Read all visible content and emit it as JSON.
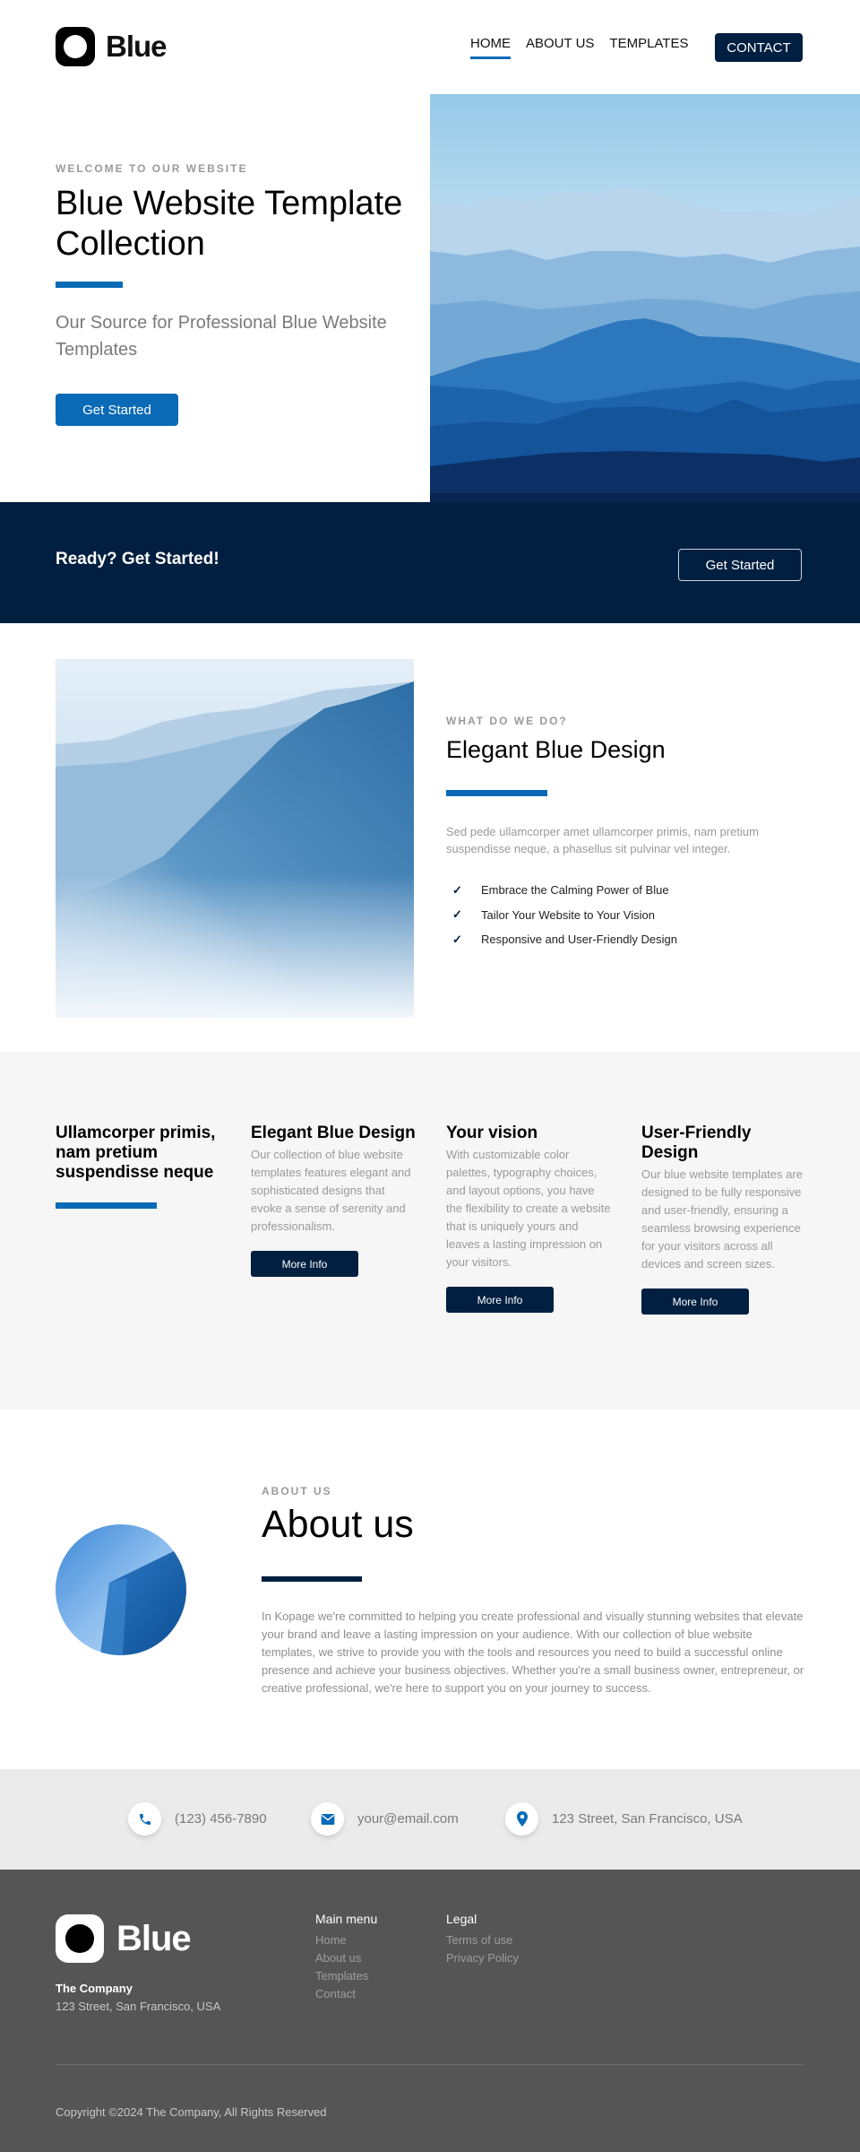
{
  "colors": {
    "accent": "#0a6ab6",
    "navy": "#011f40",
    "features_bg": "#f6f6f6",
    "contact_bg": "#ebebeb",
    "footer_bg": "#555555"
  },
  "header": {
    "logo_text": "Blue",
    "nav": [
      {
        "label": "HOME",
        "active": true
      },
      {
        "label": "ABOUT US",
        "active": false
      },
      {
        "label": "TEMPLATES",
        "active": false
      }
    ],
    "contact_button": "CONTACT"
  },
  "hero": {
    "eyebrow": "WELCOME TO OUR WEBSITE",
    "title": "Blue Website Template Collection",
    "subtitle": "Our Source for Professional Blue Website Templates",
    "button": "Get Started",
    "image_alt": "Layered blue mountain ranges in mist"
  },
  "cta": {
    "text": "Ready? Get Started!",
    "button": "Get Started"
  },
  "elegant": {
    "image_alt": "Misty blue mountain slope",
    "eyebrow": "WHAT DO WE DO?",
    "title": "Elegant Blue Design",
    "description": "Sed pede ullamcorper amet ullamcorper primis, nam pretium suspendisse neque, a phasellus sit pulvinar vel integer.",
    "checklist": [
      "Embrace the Calming Power of Blue",
      "Tailor Your Website to Your Vision",
      "Responsive and User-Friendly Design"
    ],
    "check_icon": "checkmark-icon"
  },
  "features": {
    "intro_title": "Ullamcorper primis, nam pretium suspendisse neque",
    "items": [
      {
        "title": "Elegant Blue Design",
        "description": "Our collection of blue website templates features elegant and sophisticated designs that evoke a sense of serenity and professionalism.",
        "button": "More Info"
      },
      {
        "title": "Your vision",
        "description": "With customizable color palettes, typography choices, and layout options, you have the flexibility to create a website that is uniquely yours and leaves a lasting impression on your visitors.",
        "button": "More Info"
      },
      {
        "title": "User-Friendly Design",
        "description": "Our blue website templates are designed to be fully responsive and user-friendly, ensuring a seamless browsing experience for your visitors across all devices and screen sizes.",
        "button": "More Info"
      }
    ]
  },
  "about": {
    "image_alt": "Glass skyscraper against blue sky",
    "eyebrow": "ABOUT US",
    "title": "About us",
    "text": "In Kopage we're committed to helping you create professional and visually stunning websites that elevate your brand and leave a lasting impression on your audience. With our collection of blue website templates, we strive to provide you with the tools and resources you need to build a successful online presence and achieve your business objectives. Whether you're a small business owner, entrepreneur, or creative professional, we're here to support you on your journey to success."
  },
  "contact": {
    "phone": {
      "icon": "phone-icon",
      "label": "(123) 456-7890"
    },
    "email": {
      "icon": "envelope-icon",
      "label": "your@email.com"
    },
    "address": {
      "icon": "map-pin-icon",
      "label": "123 Street, San Francisco, USA"
    }
  },
  "footer": {
    "logo_text": "Blue",
    "company": "The Company",
    "address": "123 Street, San Francisco, USA",
    "main_menu": {
      "title": "Main menu",
      "links": [
        "Home",
        "About us",
        "Templates",
        "Contact"
      ]
    },
    "legal": {
      "title": "Legal",
      "links": [
        "Terms of use",
        "Privacy Policy"
      ]
    },
    "copyright": "Copyright ©2024 The Company, All Rights Reserved"
  }
}
